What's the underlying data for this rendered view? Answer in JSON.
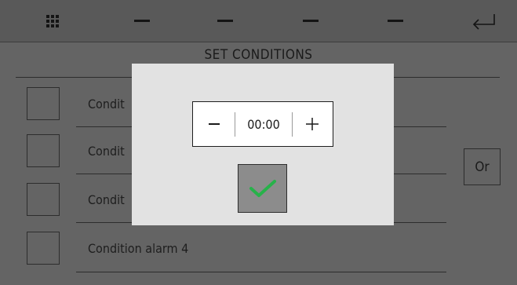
{
  "topbar": {
    "icons": [
      "grid-icon",
      "dash-icon",
      "dash-icon",
      "dash-icon",
      "dash-icon",
      "return-arrow-icon"
    ]
  },
  "page": {
    "title": "SET CONDITIONS"
  },
  "conditions": [
    {
      "label": "Condit",
      "checked": false
    },
    {
      "label": "Condit",
      "checked": false
    },
    {
      "label": "Condit",
      "checked": false
    },
    {
      "label": "Condition alarm 4",
      "checked": false
    }
  ],
  "logic_button": {
    "label": "Or"
  },
  "dialog": {
    "time_value": "00:00",
    "minus_icon": "minus-icon",
    "plus_icon": "plus-icon",
    "confirm_icon": "checkmark-icon"
  },
  "colors": {
    "background": "#646464",
    "topbar": "#595959",
    "dialog": "#e2e2e2",
    "confirm_button": "#8c8c8c",
    "checkmark": "#27b24a"
  }
}
